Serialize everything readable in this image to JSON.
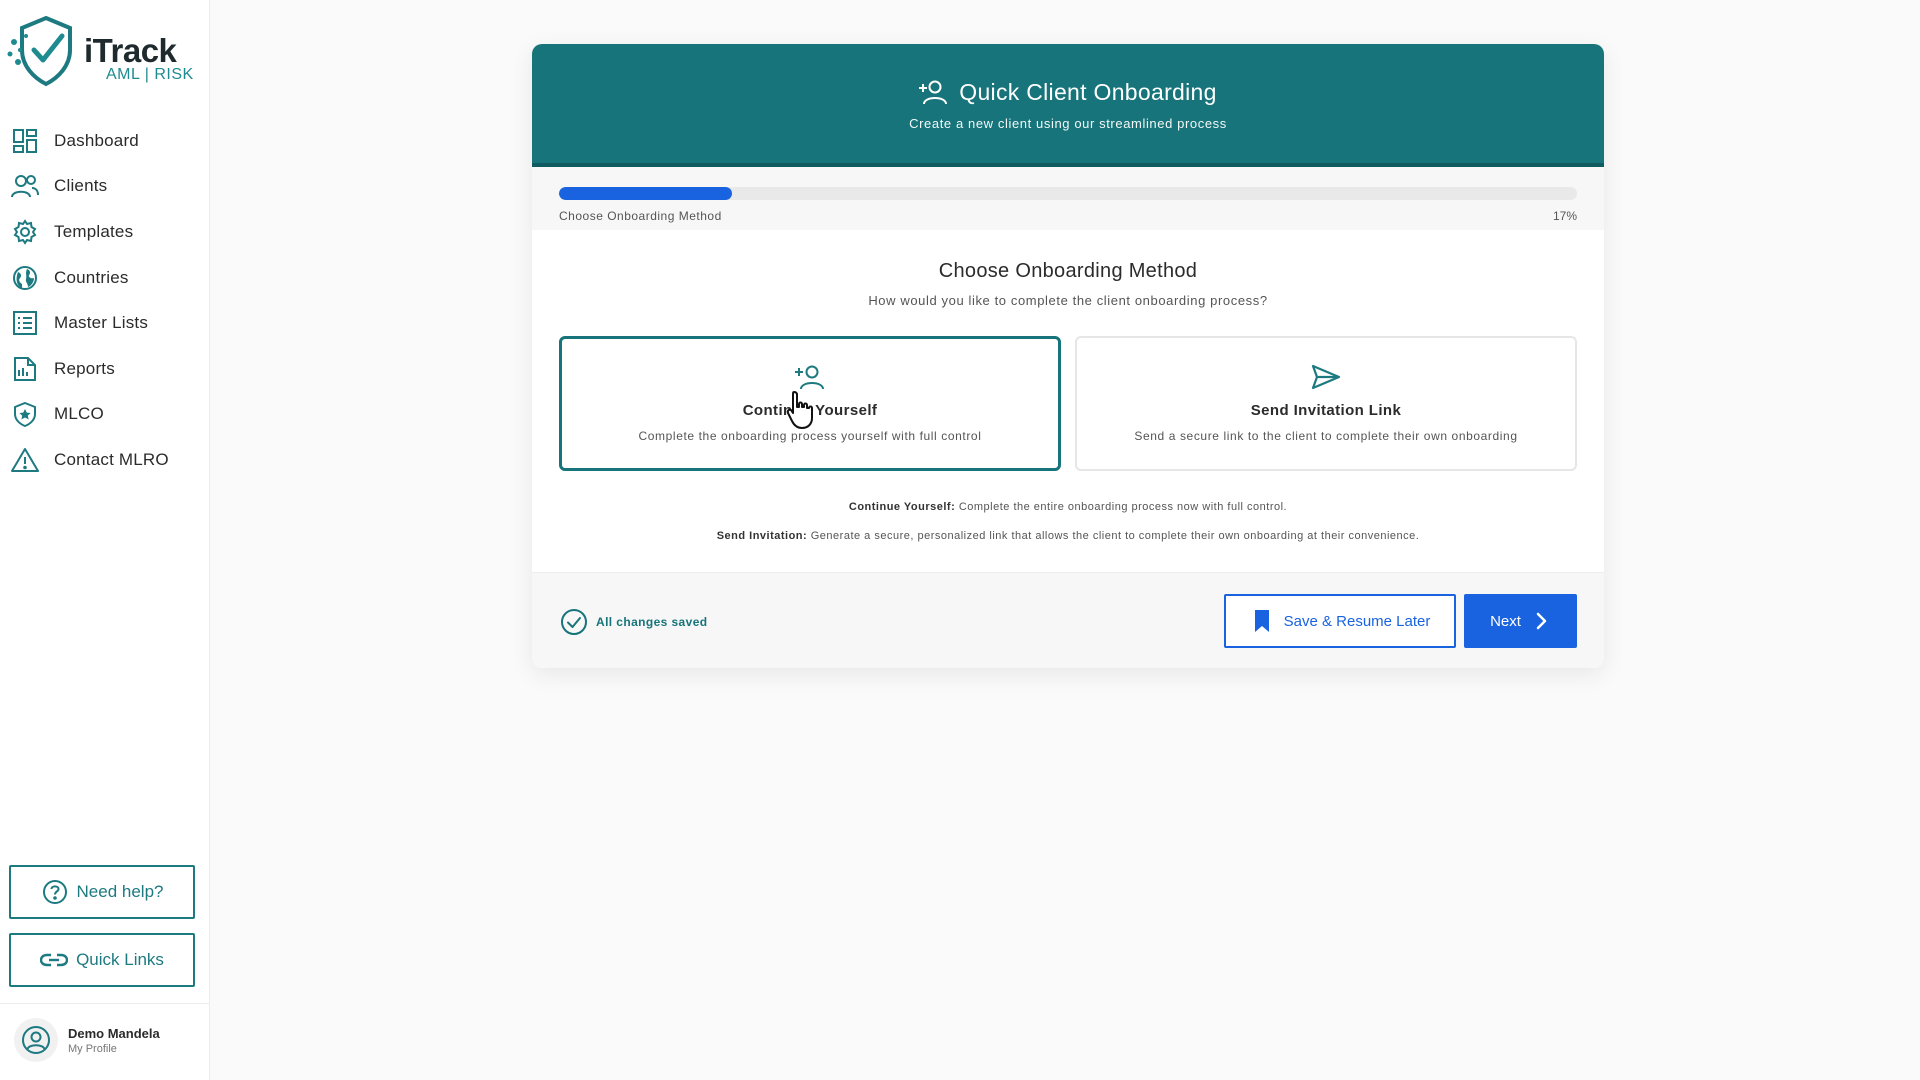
{
  "brand": {
    "name": "iTrack",
    "tagline": "AML | RISK",
    "accent": "#17747a",
    "primary_blue": "#1a63e0"
  },
  "sidebar": {
    "items": [
      {
        "label": "Dashboard",
        "icon": "dashboard-icon"
      },
      {
        "label": "Clients",
        "icon": "users-icon"
      },
      {
        "label": "Templates",
        "icon": "gear-icon"
      },
      {
        "label": "Countries",
        "icon": "globe-icon"
      },
      {
        "label": "Master Lists",
        "icon": "list-icon"
      },
      {
        "label": "Reports",
        "icon": "report-icon"
      },
      {
        "label": "MLCO",
        "icon": "shield-star-icon"
      },
      {
        "label": "Contact MLRO",
        "icon": "warning-icon"
      }
    ],
    "help_label": "Need help?",
    "links_label": "Quick Links"
  },
  "profile": {
    "name": "Demo Mandela",
    "subtitle": "My Profile"
  },
  "wizard": {
    "title": "Quick Client Onboarding",
    "subtitle": "Create a new client using our streamlined process",
    "progress": {
      "step_label": "Choose Onboarding Method",
      "percent_label": "17%",
      "percent": 17
    },
    "step_title": "Choose Onboarding Method",
    "step_subtitle": "How would you like to complete the client onboarding process?",
    "options": [
      {
        "title": "Continue Yourself",
        "desc": "Complete the onboarding process yourself with full control",
        "icon": "user-plus-icon",
        "selected": true
      },
      {
        "title": "Send Invitation Link",
        "desc": "Send a secure link to the client to complete their own onboarding",
        "icon": "send-icon",
        "selected": false
      }
    ],
    "explain": [
      {
        "label": "Continue Yourself:",
        "text": "Complete the entire onboarding process now with full control."
      },
      {
        "label": "Send Invitation:",
        "text": "Generate a secure, personalized link that allows the client to complete their own onboarding at their convenience."
      }
    ],
    "saved_text": "All changes saved",
    "save_label": "Save & Resume Later",
    "next_label": "Next"
  }
}
